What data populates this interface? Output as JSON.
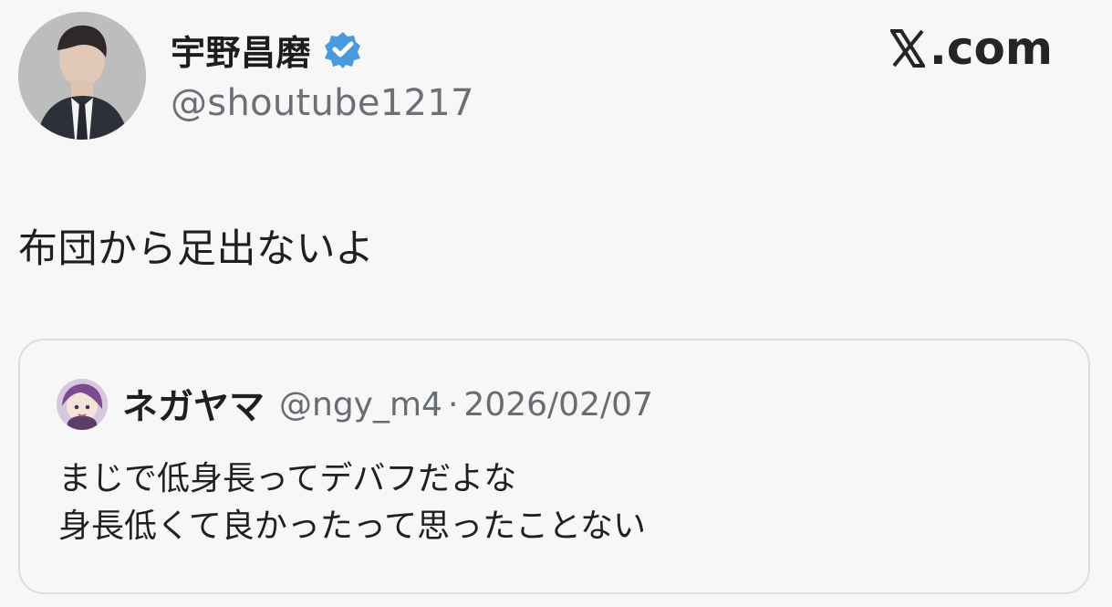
{
  "post": {
    "author_name": "宇野昌磨",
    "author_handle": "@shoutube1217",
    "source_label": ".com",
    "text": "布団から足出ないよ"
  },
  "quoted_post": {
    "author_name": "ネガヤマ",
    "author_handle": "@ngy_m4",
    "separator": "·",
    "date": "2026/02/07",
    "lines": [
      "まじで低身長ってデバフだよな",
      "身長低くて良かったって思ったことない"
    ]
  },
  "icons": {
    "verified": "verified-badge-icon",
    "x_logo": "x-logo-icon"
  },
  "colors": {
    "verified_blue": "#4a9bdd",
    "text_primary": "#1f1f1f",
    "text_secondary": "#6b7076",
    "card_border": "#dedede",
    "background": "#f7f7f7"
  }
}
